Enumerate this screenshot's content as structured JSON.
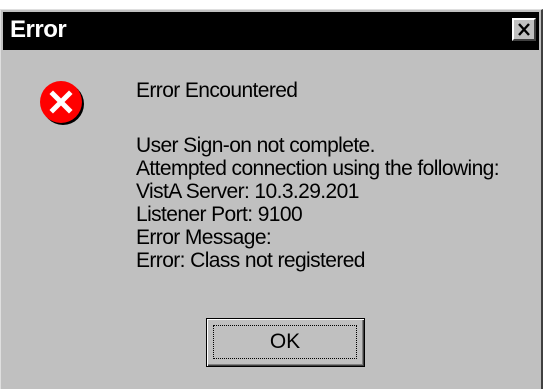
{
  "window": {
    "title": "Error",
    "close_glyph": "✕"
  },
  "icon": {
    "name": "error-icon",
    "color": "#ff0000",
    "glyph": "X"
  },
  "message": {
    "heading": "Error Encountered",
    "lines": [
      "User Sign-on not complete.",
      "Attempted connection using the following:",
      "VistA Server: 10.3.29.201",
      "Listener Port: 9100",
      "Error Message:",
      "Error: Class not registered"
    ]
  },
  "buttons": {
    "ok_label": "OK"
  },
  "colors": {
    "titlebar": "#000000",
    "face": "#c0c0c0",
    "error_red": "#ff0000"
  }
}
